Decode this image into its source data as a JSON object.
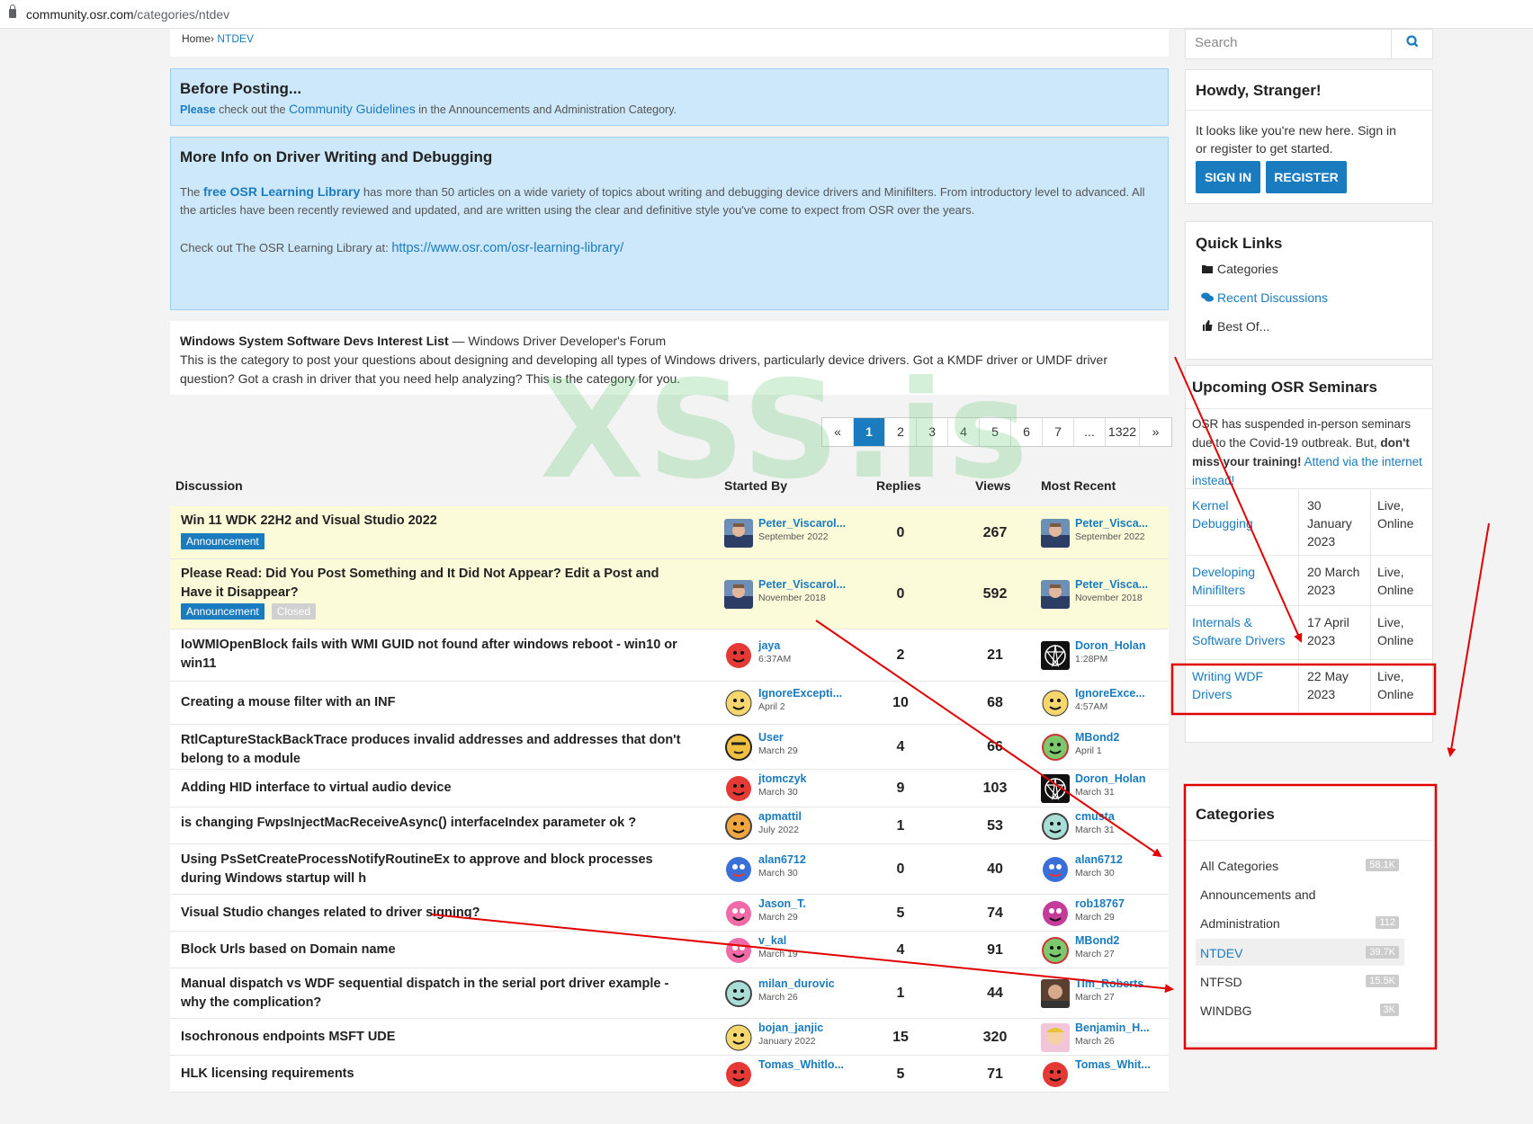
{
  "browser": {
    "url_host": "community.osr.com",
    "url_path": "/categories/ntdev"
  },
  "breadcrumb": {
    "home": "Home",
    "sep": "›",
    "current": "NTDEV"
  },
  "before_posting": {
    "title": "Before Posting...",
    "please": "Please",
    "text1": " check out the ",
    "link": "Community Guidelines",
    "text2": " in the Announcements and Administration Category."
  },
  "more_info": {
    "title": "More Info on Driver Writing and Debugging",
    "p1_pre": "The ",
    "p1_link": "free OSR Learning Library",
    "p1_post": " has more than 50 articles on a wide variety of topics about writing and debugging device drivers and Minifilters. From introductory level to advanced. All the articles have been recently reviewed and updated, and are written using the clear and definitive style you've come to expect from OSR over the years.",
    "p2_pre": "Check out The OSR Learning Library at: ",
    "p2_link": "https://www.osr.com/osr-learning-library/"
  },
  "category": {
    "name": "Windows System Software Devs Interest List",
    "dash": " — ",
    "forum": "Windows Driver Developer's Forum",
    "description": "This is the category to post your questions about designing and developing all types of Windows drivers, particularly device drivers. Got a KMDF driver or UMDF driver question? Got a crash in driver that you need help analyzing? This is the category for you."
  },
  "pager": [
    "«",
    "1",
    "2",
    "3",
    "4",
    "5",
    "6",
    "7",
    "...",
    "1322",
    "»"
  ],
  "pager_active": "1",
  "watermark": "XSS.is",
  "table": {
    "headers": {
      "discussion": "Discussion",
      "started_by": "Started By",
      "replies": "Replies",
      "views": "Views",
      "most_recent": "Most Recent"
    },
    "rows": [
      {
        "title": "Win 11 WDK 22H2 and Visual Studio 2022",
        "badges": [
          "Announcement"
        ],
        "starter": "Peter_Viscarol...",
        "start_date": "September 2022",
        "replies": "0",
        "views": "267",
        "recent": "Peter_Visca...",
        "recent_date": "September 2022",
        "ann": true
      },
      {
        "title": "Please Read: Did You Post Something and It Did Not Appear? Edit a Post and Have it Disappear?",
        "badges": [
          "Announcement",
          "Closed"
        ],
        "starter": "Peter_Viscarol...",
        "start_date": "November 2018",
        "replies": "0",
        "views": "592",
        "recent": "Peter_Visca...",
        "recent_date": "November 2018",
        "ann": true
      },
      {
        "title": "IoWMIOpenBlock fails with WMI GUID not found after windows reboot - win10 or win11",
        "badges": [],
        "starter": "jaya",
        "start_date": "6:37AM",
        "replies": "2",
        "views": "21",
        "recent": "Doron_Holan",
        "recent_date": "1:28PM"
      },
      {
        "title": "Creating a mouse filter with an INF",
        "badges": [],
        "starter": "IgnoreExcepti...",
        "start_date": "April 2",
        "replies": "10",
        "views": "68",
        "recent": "IgnoreExce...",
        "recent_date": "4:57AM"
      },
      {
        "title": "RtlCaptureStackBackTrace produces invalid addresses and addresses that don't belong to a module",
        "badges": [],
        "starter": "User",
        "start_date": "March 29",
        "replies": "4",
        "views": "66",
        "recent": "MBond2",
        "recent_date": "April 1"
      },
      {
        "title": "Adding HID interface to virtual audio device",
        "badges": [],
        "starter": "jtomczyk",
        "start_date": "March 30",
        "replies": "9",
        "views": "103",
        "recent": "Doron_Holan",
        "recent_date": "March 31"
      },
      {
        "title": "is changing FwpsInjectMacReceiveAsync() interfaceIndex parameter ok ?",
        "badges": [],
        "starter": "apmattil",
        "start_date": "July 2022",
        "replies": "1",
        "views": "53",
        "recent": "cmusta",
        "recent_date": "March 31"
      },
      {
        "title": "Using PsSetCreateProcessNotifyRoutineEx to approve and block processes during Windows startup will h",
        "badges": [],
        "starter": "alan6712",
        "start_date": "March 30",
        "replies": "0",
        "views": "40",
        "recent": "alan6712",
        "recent_date": "March 30"
      },
      {
        "title": "Visual Studio changes related to driver signing?",
        "badges": [],
        "starter": "Jason_T.",
        "start_date": "March 29",
        "replies": "5",
        "views": "74",
        "recent": "rob18767",
        "recent_date": "March 29"
      },
      {
        "title": "Block Urls based on Domain name",
        "badges": [],
        "starter": "v_kal",
        "start_date": "March 19",
        "replies": "4",
        "views": "91",
        "recent": "MBond2",
        "recent_date": "March 27"
      },
      {
        "title": "Manual dispatch vs WDF sequential dispatch in the serial port driver example - why the complication?",
        "badges": [],
        "starter": "milan_durovic",
        "start_date": "March 26",
        "replies": "1",
        "views": "44",
        "recent": "Tim_Roberts",
        "recent_date": "March 27"
      },
      {
        "title": "Isochronous endpoints MSFT UDE",
        "badges": [],
        "starter": "bojan_janjic",
        "start_date": "January 2022",
        "replies": "15",
        "views": "320",
        "recent": "Benjamin_H...",
        "recent_date": "March 26"
      },
      {
        "title": "HLK licensing requirements",
        "badges": [],
        "starter": "Tomas_Whitlo...",
        "start_date": "",
        "replies": "5",
        "views": "71",
        "recent": "Tomas_Whit...",
        "recent_date": ""
      }
    ]
  },
  "sidebar": {
    "search_placeholder": "Search",
    "howdy": {
      "title": "Howdy, Stranger!",
      "text": "It looks like you're new here. Sign in or register to get started.",
      "signin": "SIGN IN",
      "register": "REGISTER"
    },
    "quick_links": {
      "title": "Quick Links",
      "items": [
        "Categories",
        "Recent Discussions",
        "Best Of..."
      ]
    },
    "seminars": {
      "title": "Upcoming OSR Seminars",
      "intro_pre": "OSR has suspended in-person seminars due to the Covid-19 outbreak. But, ",
      "intro_bold": "don't miss your training!",
      "intro_link": "Attend via the internet instead!",
      "rows": [
        {
          "name": "Kernel Debugging",
          "date": "30 January 2023",
          "mode": "Live, Online"
        },
        {
          "name": "Developing Minifilters",
          "date": "20 March 2023",
          "mode": "Live, Online"
        },
        {
          "name": "Internals & Software Drivers",
          "date": "17 April 2023",
          "mode": "Live, Online"
        },
        {
          "name": "Writing WDF Drivers",
          "date": "22 May 2023",
          "mode": "Live, Online"
        }
      ]
    },
    "categories": {
      "title": "Categories",
      "items": [
        {
          "name": "All Categories",
          "count": "58.1K"
        },
        {
          "name": "Announcements and Administration",
          "count": "112"
        },
        {
          "name": "NTDEV",
          "count": "39.7K"
        },
        {
          "name": "NTFSD",
          "count": "15.5K"
        },
        {
          "name": "WINDBG",
          "count": "3K"
        }
      ]
    }
  },
  "colors": {
    "link": "#1a7bbf",
    "annotation_red": "#e00000",
    "announcement_bg": "#fcfbd9",
    "info_box_bg": "#cde8fa"
  }
}
